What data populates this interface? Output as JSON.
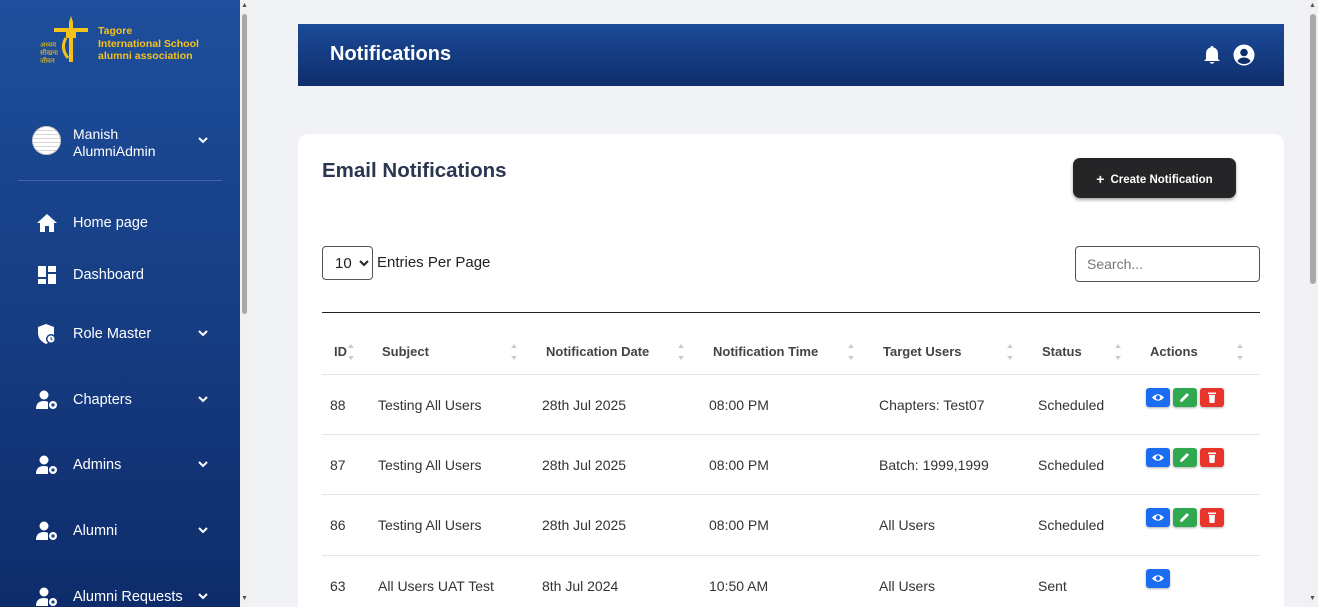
{
  "brand": {
    "logo_text_line1": "Tagore",
    "logo_text_line2": "International School",
    "logo_text_line3": "alumni association"
  },
  "user": {
    "first": "Manish",
    "last": "AlumniAdmin"
  },
  "sidebar": {
    "items": [
      {
        "label": "Home page",
        "icon": "home-icon"
      },
      {
        "label": "Dashboard",
        "icon": "dashboard-icon"
      },
      {
        "label": "Role Master",
        "icon": "role-shield-icon"
      },
      {
        "label": "Chapters",
        "icon": "user-gear-icon"
      },
      {
        "label": "Admins",
        "icon": "user-gear-icon"
      },
      {
        "label": "Alumni",
        "icon": "user-gear-icon"
      },
      {
        "label": "Alumni Requests",
        "icon": "user-gear-icon"
      }
    ]
  },
  "header": {
    "title": "Notifications"
  },
  "card": {
    "title": "Email Notifications",
    "create_label": "Create Notification",
    "entries_value": "10",
    "entries_label": "Entries Per Page",
    "search_placeholder": "Search..."
  },
  "table": {
    "columns": [
      "ID",
      "Subject",
      "Notification Date",
      "Notification Time",
      "Target Users",
      "Status",
      "Actions"
    ],
    "rows": [
      {
        "id": "88",
        "subject": "Testing All Users",
        "date": "28th Jul 2025",
        "time": "08:00 PM",
        "target": "Chapters: Test07",
        "status": "Scheduled",
        "actions": [
          "view",
          "edit",
          "delete"
        ]
      },
      {
        "id": "87",
        "subject": "Testing All Users",
        "date": "28th Jul 2025",
        "time": "08:00 PM",
        "target": "Batch: 1999,1999",
        "status": "Scheduled",
        "actions": [
          "view",
          "edit",
          "delete"
        ]
      },
      {
        "id": "86",
        "subject": "Testing All Users",
        "date": "28th Jul 2025",
        "time": "08:00 PM",
        "target": "All Users",
        "status": "Scheduled",
        "actions": [
          "view",
          "edit",
          "delete"
        ]
      },
      {
        "id": "63",
        "subject": "All Users UAT Test",
        "date": "8th Jul 2024",
        "time": "10:50 AM",
        "target": "All Users",
        "status": "Sent",
        "actions": [
          "view"
        ]
      }
    ]
  },
  "colors": {
    "sidebar_top": "#1e4f9c",
    "sidebar_bottom": "#0e2c6a",
    "header": "#1b4a98",
    "logo_gold": "#f4c21a",
    "view": "#1a6cf0",
    "edit": "#2fa84f",
    "delete": "#e8352b"
  }
}
